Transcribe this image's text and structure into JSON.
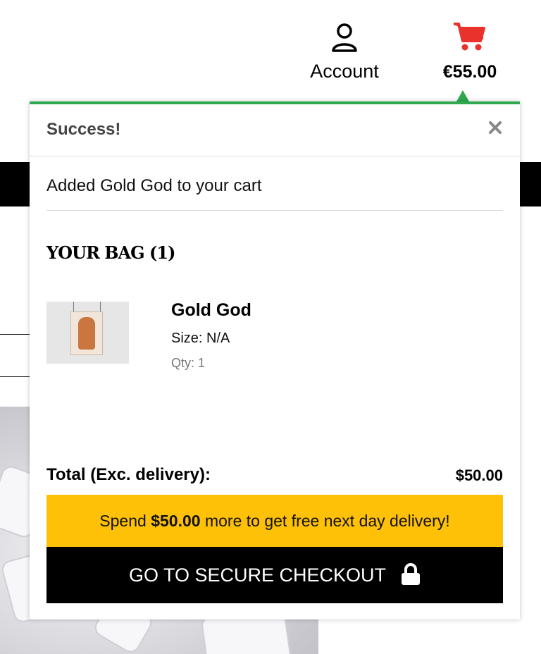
{
  "header": {
    "account_label": "Account",
    "account_icon": "user-icon",
    "cart_total": "€55.00",
    "cart_icon": "shopping-cart-icon",
    "cart_icon_color": "#e8322b"
  },
  "toast": {
    "accent_color": "#2fa84f",
    "title": "Success!",
    "close_icon": "close-icon",
    "message": "Added Gold God to your cart",
    "bag_heading": "YOUR BAG (1)",
    "item": {
      "name": "Gold God",
      "size": "Size: N/A",
      "qty": "Qty: 1"
    },
    "total_label": "Total (Exc. delivery):",
    "total_value": "$50.00",
    "promo": {
      "prefix": "Spend",
      "amount": "$50.00",
      "suffix": "more to get free next day delivery!",
      "color": "#ffc107"
    },
    "checkout_label": "GO TO SECURE CHECKOUT",
    "checkout_icon": "lock-icon"
  }
}
